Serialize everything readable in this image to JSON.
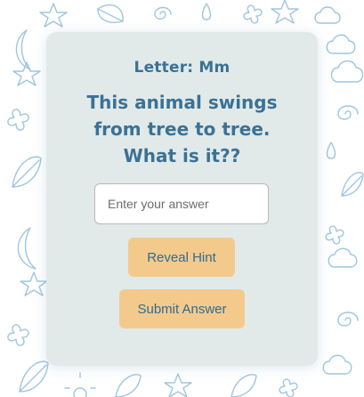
{
  "card": {
    "letter_label": "Letter: Mm",
    "question": "This animal swings from tree to tree. What is it??"
  },
  "answer": {
    "placeholder": "Enter your answer",
    "value": ""
  },
  "buttons": {
    "hint_label": "Reveal Hint",
    "submit_label": "Submit Answer"
  },
  "colors": {
    "card_background": "#e1eae8",
    "heading_text": "#3b7196",
    "button_background": "#f4ca8c",
    "pattern_stroke": "#9fc6df"
  },
  "background_pattern_icons": [
    "cloud-icon",
    "star-icon",
    "moon-icon",
    "leaf-icon",
    "flower-icon",
    "spiral-icon",
    "drop-icon",
    "sun-icon"
  ]
}
